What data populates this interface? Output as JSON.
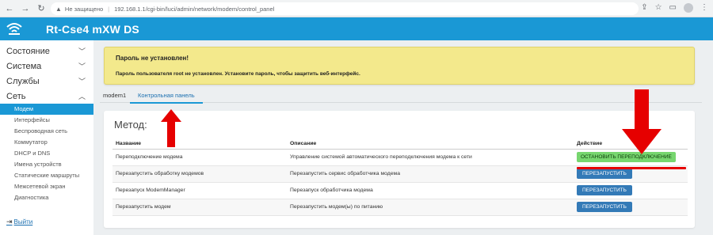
{
  "browser": {
    "security_label": "Не защищено",
    "url": "192.168.1.1/cgi-bin/luci/admin/network/modem/control_panel"
  },
  "header": {
    "title": "Rt-Cse4 mXW DS"
  },
  "sidebar": {
    "menus": [
      {
        "label": "Состояние"
      },
      {
        "label": "Система"
      },
      {
        "label": "Службы"
      },
      {
        "label": "Сеть"
      }
    ],
    "items": [
      {
        "label": "Модем"
      },
      {
        "label": "Интерфейсы"
      },
      {
        "label": "Беспроводная сеть"
      },
      {
        "label": "Коммутатор"
      },
      {
        "label": "DHCP и DNS"
      },
      {
        "label": "Имена устройств"
      },
      {
        "label": "Статические маршруты"
      },
      {
        "label": "Межсетевой экран"
      },
      {
        "label": "Диагностика"
      }
    ],
    "logout_label": "Выйти"
  },
  "alert": {
    "heading": "Пароль не установлен!",
    "text": "Пароль пользователя root не установлен. Установите пароль, чтобы защитить веб-интерфейс."
  },
  "tabs": [
    {
      "label": "modem1"
    },
    {
      "label": "Контрольная панель"
    }
  ],
  "panel": {
    "legend": "Метод:",
    "columns": [
      "Название",
      "Описание",
      "Действие"
    ],
    "rows": [
      {
        "name": "Переподключение модема",
        "description": "Управление системой автоматического переподключения модема к сети",
        "action": "ОСТАНОВИТЬ ПЕРЕПОДКЛЮЧЕНИЕ"
      },
      {
        "name": "Перезапустить обработку модемов",
        "description": "Перезапустить сервис обработчика модема",
        "action": "ПЕРЕЗАПУСТИТЬ"
      },
      {
        "name": "Перезапуск ModemManager",
        "description": "Перезапуск обработчика модема",
        "action": "ПЕРЕЗАПУСТИТЬ"
      },
      {
        "name": "Перезапустить модем",
        "description": "Перезапустить модем(ы) по питанию",
        "action": "ПЕРЕЗАПУСТИТЬ"
      }
    ]
  },
  "colors": {
    "header": "#1a98d5",
    "alert": "#f3e98c",
    "primary_button": "#337ab7",
    "success_button": "#77d66f",
    "annotation": "#e60000"
  }
}
